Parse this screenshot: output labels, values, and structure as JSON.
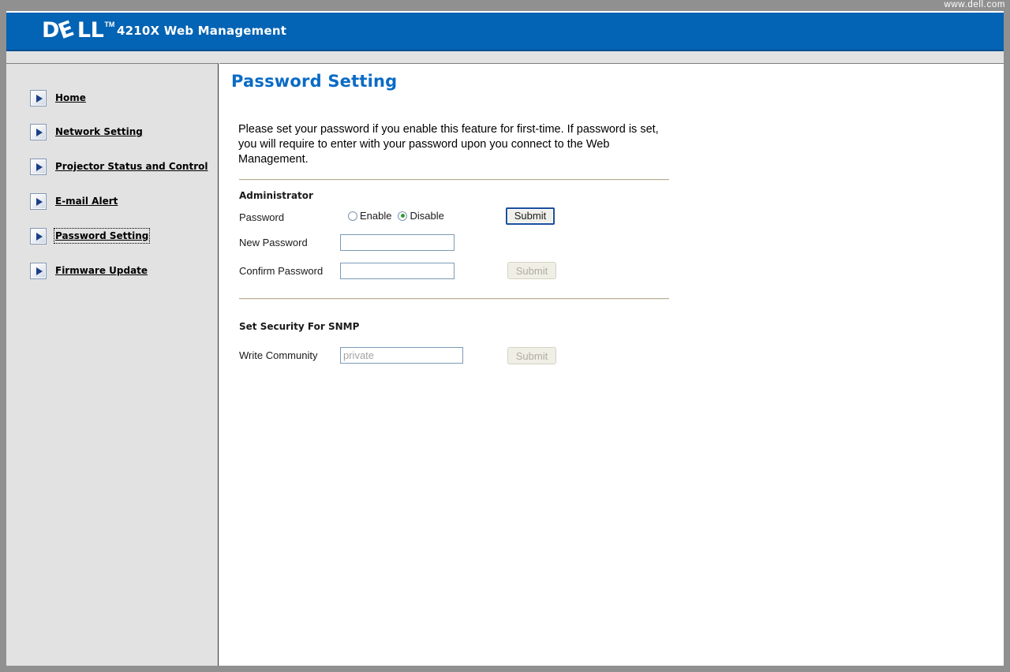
{
  "topbar": {
    "url": "www.dell.com"
  },
  "banner": {
    "logo_d": "D",
    "logo_e": "E",
    "logo_ll": "LL",
    "logo_tm": "TM",
    "title": "4210X Web Management",
    "background_color": "#0363b4"
  },
  "sidebar": {
    "items": [
      {
        "label": "Home",
        "icon": "play-triangle-icon",
        "focused": false
      },
      {
        "label": "Network Setting",
        "icon": "play-triangle-icon",
        "focused": false
      },
      {
        "label": "Projector Status and Control",
        "icon": "play-triangle-icon",
        "focused": false
      },
      {
        "label": "E-mail Alert",
        "icon": "play-triangle-icon",
        "focused": false
      },
      {
        "label": "Password Setting",
        "icon": "play-triangle-icon",
        "focused": true
      },
      {
        "label": "Firmware Update",
        "icon": "play-triangle-icon",
        "focused": false
      }
    ]
  },
  "main": {
    "page_title": "Password Setting",
    "title_color": "#0a6bc4",
    "intro": "Please set your password if you enable this feature for first-time. If password is set, you will require to enter with your password upon you connect to the Web Management.",
    "administrator": {
      "heading": "Administrator",
      "password_label": "Password",
      "radio_enable": "Enable",
      "radio_disable": "Disable",
      "selected_radio": "Disable",
      "radio_selected_color": "#2e9c2e",
      "submit_label": "Submit",
      "new_password_label": "New Password",
      "new_password_value": "",
      "new_password_placeholder": "",
      "confirm_password_label": "Confirm Password",
      "confirm_password_value": "",
      "confirm_password_placeholder": "",
      "confirm_submit_label": "Submit",
      "confirm_submit_disabled": true
    },
    "snmp": {
      "heading": "Set Security For SNMP",
      "write_community_label": "Write Community",
      "write_community_value": "",
      "write_community_placeholder": "private",
      "submit_label": "Submit",
      "submit_disabled": true
    }
  }
}
